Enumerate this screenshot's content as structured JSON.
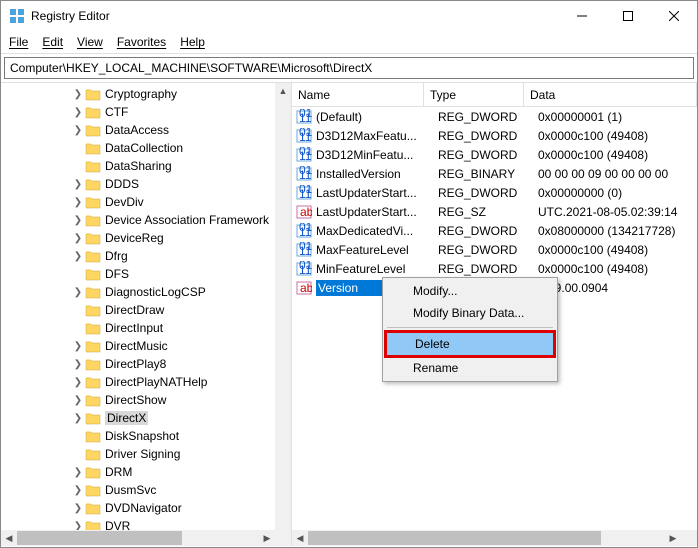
{
  "window": {
    "title": "Registry Editor"
  },
  "menu": {
    "file": "File",
    "edit": "Edit",
    "view": "View",
    "favorites": "Favorites",
    "help": "Help"
  },
  "address": "Computer\\HKEY_LOCAL_MACHINE\\SOFTWARE\\Microsoft\\DirectX",
  "tree": [
    {
      "label": "Cryptography",
      "expandable": true
    },
    {
      "label": "CTF",
      "expandable": true
    },
    {
      "label": "DataAccess",
      "expandable": true
    },
    {
      "label": "DataCollection",
      "expandable": false
    },
    {
      "label": "DataSharing",
      "expandable": false
    },
    {
      "label": "DDDS",
      "expandable": true
    },
    {
      "label": "DevDiv",
      "expandable": true
    },
    {
      "label": "Device Association Framework",
      "expandable": true
    },
    {
      "label": "DeviceReg",
      "expandable": true
    },
    {
      "label": "Dfrg",
      "expandable": true
    },
    {
      "label": "DFS",
      "expandable": false
    },
    {
      "label": "DiagnosticLogCSP",
      "expandable": true
    },
    {
      "label": "DirectDraw",
      "expandable": false
    },
    {
      "label": "DirectInput",
      "expandable": false
    },
    {
      "label": "DirectMusic",
      "expandable": true
    },
    {
      "label": "DirectPlay8",
      "expandable": true
    },
    {
      "label": "DirectPlayNATHelp",
      "expandable": true
    },
    {
      "label": "DirectShow",
      "expandable": true
    },
    {
      "label": "DirectX",
      "expandable": true,
      "selected": true
    },
    {
      "label": "DiskSnapshot",
      "expandable": false
    },
    {
      "label": "Driver Signing",
      "expandable": false
    },
    {
      "label": "DRM",
      "expandable": true
    },
    {
      "label": "DusmSvc",
      "expandable": true
    },
    {
      "label": "DVDNavigator",
      "expandable": true
    },
    {
      "label": "DVR",
      "expandable": true
    }
  ],
  "columns": {
    "name": "Name",
    "type": "Type",
    "data": "Data"
  },
  "values": [
    {
      "name": "(Default)",
      "type": "REG_DWORD",
      "data": "0x00000001 (1)",
      "kind": "bin"
    },
    {
      "name": "D3D12MaxFeatu...",
      "type": "REG_DWORD",
      "data": "0x0000c100 (49408)",
      "kind": "bin"
    },
    {
      "name": "D3D12MinFeatu...",
      "type": "REG_DWORD",
      "data": "0x0000c100 (49408)",
      "kind": "bin"
    },
    {
      "name": "InstalledVersion",
      "type": "REG_BINARY",
      "data": "00 00 00 09 00 00 00 00",
      "kind": "bin"
    },
    {
      "name": "LastUpdaterStart...",
      "type": "REG_DWORD",
      "data": "0x00000000 (0)",
      "kind": "bin"
    },
    {
      "name": "LastUpdaterStart...",
      "type": "REG_SZ",
      "data": "UTC.2021-08-05.02:39:14",
      "kind": "str"
    },
    {
      "name": "MaxDedicatedVi...",
      "type": "REG_DWORD",
      "data": "0x08000000 (134217728)",
      "kind": "bin"
    },
    {
      "name": "MaxFeatureLevel",
      "type": "REG_DWORD",
      "data": "0x0000c100 (49408)",
      "kind": "bin"
    },
    {
      "name": "MinFeatureLevel",
      "type": "REG_DWORD",
      "data": "0x0000c100 (49408)",
      "kind": "bin"
    },
    {
      "name": "Version",
      "type": "REG_SZ",
      "data": "4.09.00.0904",
      "kind": "str",
      "selected": true
    }
  ],
  "contextmenu": {
    "modify": "Modify...",
    "modify_binary": "Modify Binary Data...",
    "delete": "Delete",
    "rename": "Rename"
  }
}
